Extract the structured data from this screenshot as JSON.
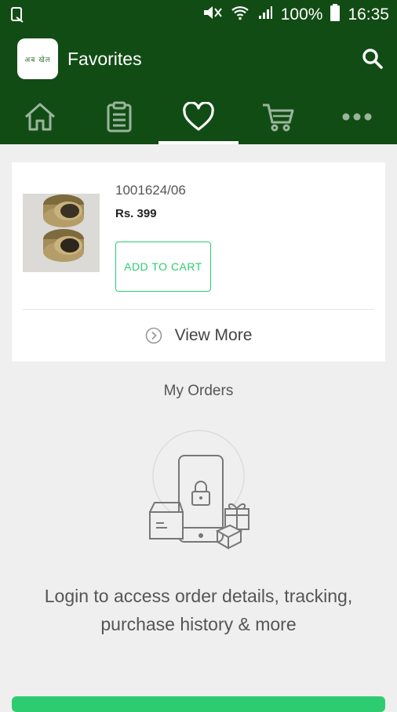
{
  "status_bar": {
    "battery": "100%",
    "time": "16:35"
  },
  "app_bar": {
    "logo_text": "अब खेल",
    "title": "Favorites"
  },
  "tabs": [
    {
      "name": "home",
      "icon": "home-icon",
      "active": false
    },
    {
      "name": "orders",
      "icon": "clipboard-icon",
      "active": false
    },
    {
      "name": "favorites",
      "icon": "heart-icon",
      "active": true
    },
    {
      "name": "cart",
      "icon": "cart-icon",
      "active": false
    },
    {
      "name": "more",
      "icon": "more-icon",
      "active": false
    }
  ],
  "favorite_item": {
    "sku": "1001624/06",
    "price": "Rs. 399",
    "add_to_cart_label": "ADD TO CART",
    "view_more_label": "View More"
  },
  "my_orders": {
    "title": "My Orders",
    "login_message": "Login to access order details, tracking, purchase history & more"
  },
  "colors": {
    "primary": "#124c15",
    "accent": "#2ecc71",
    "background": "#efefef"
  }
}
